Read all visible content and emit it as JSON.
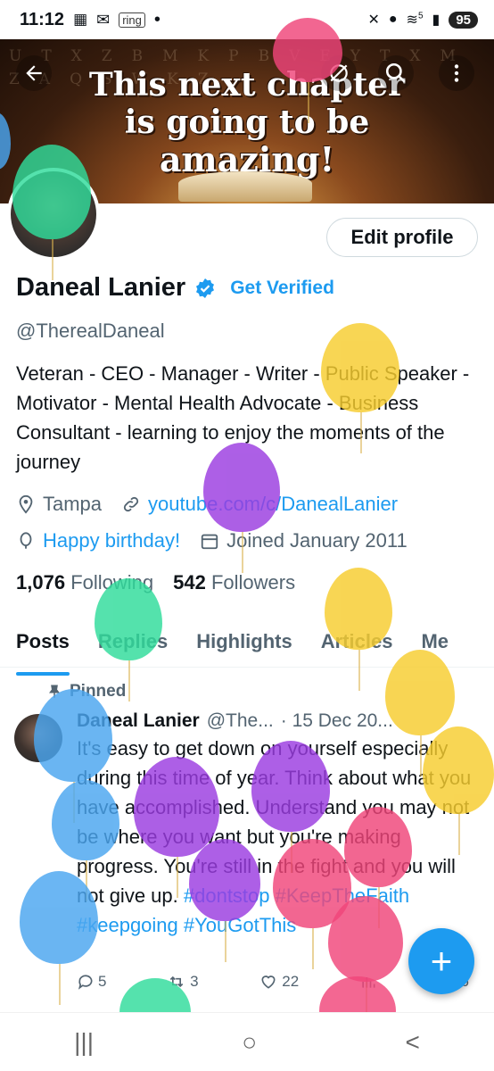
{
  "status_bar": {
    "time": "11:12",
    "notification_chip": "ring",
    "dot": "•",
    "battery": "95",
    "signal_label": "5"
  },
  "banner": {
    "line1": "This next chapter",
    "line2": "is going to be",
    "line3": "amazing!",
    "background_letters": "UTXZBMKPBVEYTXMZAQSWKZ"
  },
  "header_actions": {
    "back_icon": "arrow-left-icon",
    "circle_icon": "circle-slash-icon",
    "search_icon": "search-icon",
    "more_icon": "more-vertical-icon"
  },
  "profile": {
    "edit_profile_label": "Edit profile",
    "name": "Daneal Lanier",
    "get_verified_label": "Get Verified",
    "handle": "@TherealDaneal",
    "bio": "Veteran - CEO - Manager - Writer - Public Speaker - Motivator - Mental Health Advocate - Business Consultant - learning to enjoy the moments of the journey",
    "location": "Tampa",
    "website": "youtube.com/c/DanealLanier",
    "birthday": "Happy birthday!",
    "joined": "Joined January 2011",
    "following_count": "1,076",
    "following_label": "Following",
    "followers_count": "542",
    "followers_label": "Followers"
  },
  "tabs": [
    {
      "label": "Posts",
      "active": true
    },
    {
      "label": "Replies",
      "active": false
    },
    {
      "label": "Highlights",
      "active": false
    },
    {
      "label": "Articles",
      "active": false
    },
    {
      "label": "Me",
      "active": false
    }
  ],
  "tweet": {
    "pinned_label": "Pinned",
    "author_name": "Daneal Lanier",
    "author_handle": "@The...",
    "date": "· 15 Dec 20...",
    "text": "It's easy to get down on yourself especially during this time of year. Think about what you have accomplished. Understand you may not be where you want but you're making progress. You're still in the fight and you will not give up.",
    "hashtags": "#dontstop #KeepTheFaith #keepgoing #YouGotThis",
    "replies": "5",
    "reposts": "3",
    "likes": "22",
    "views": "",
    "bookmark_count": "6"
  },
  "fab_label": "+",
  "navbar": {
    "recents": "|||",
    "home": "○",
    "back": "<"
  },
  "colors": {
    "accent": "#1d9bf0",
    "text": "#0f1419",
    "muted": "#536471",
    "balloon_green": "#2fdc9b",
    "balloon_yellow": "#f7cd2e",
    "balloon_purple": "#9b3ce0",
    "balloon_blue": "#4aa6f0",
    "balloon_red": "#f0457a"
  }
}
